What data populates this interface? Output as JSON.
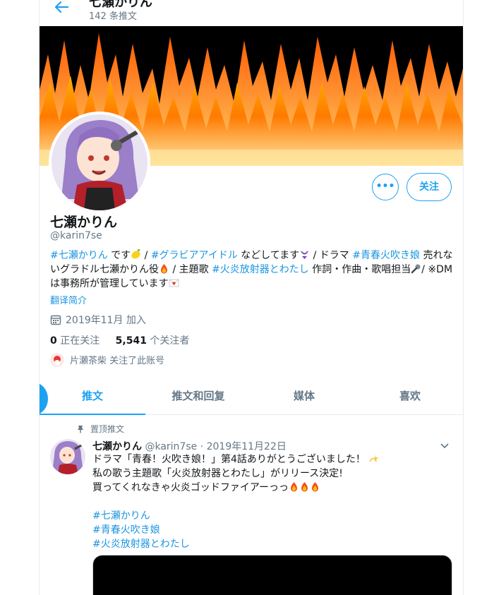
{
  "header": {
    "back_label": "←",
    "title": "七瀬かりん",
    "tweet_count": "142 条推文"
  },
  "profile": {
    "name": "七瀬かりん",
    "handle": "@karin7se",
    "bio": {
      "tag1": "#七瀬かりん",
      "t1": " です",
      "t2": " / ",
      "tag2": "#グラビアアイドル",
      "t3": " などしてます",
      "t4": " / ドラマ ",
      "tag3": "#青春火吹き娘",
      "t5": " 売れないグラドル七瀬かりん役",
      "t6": " / 主題歌 ",
      "tag4": "#火炎放射器とわたし",
      "t7": " 作詞・作曲・歌唱担当",
      "t8": "/ ※DMは事務所が管理しています"
    },
    "translate_label": "翻译简介",
    "joined": "2019年11月 加入",
    "following_count": "0",
    "following_label": "正在关注",
    "followers_count": "5,541",
    "followers_label": "个关注者",
    "followed_by": "片瀬茶柴 关注了此账号",
    "more_label": "•••",
    "follow_label": "关注"
  },
  "tabs": [
    {
      "label": "推文",
      "active": true
    },
    {
      "label": "推文和回复",
      "active": false
    },
    {
      "label": "媒体",
      "active": false
    },
    {
      "label": "喜欢",
      "active": false
    }
  ],
  "tweet": {
    "pinned_label": "置顶推文",
    "name": "七瀬かりん",
    "handle": "@karin7se",
    "separator": " · ",
    "date": "2019年11月22日",
    "line1": "ドラマ「青春！火吹き娘！」第4話ありがとうございました！",
    "line2": "私の歌う主題歌「火炎放射器とわたし」がリリース決定!",
    "line3": "買ってくれなきゃ火炎ゴッドファイアーっっ",
    "hashtags": [
      "#七瀬かりん",
      "#青春火吹き娘",
      "#火炎放射器とわたし"
    ]
  },
  "colors": {
    "accent": "#1da1f2",
    "link": "#1b95e0",
    "muted": "#657786"
  }
}
